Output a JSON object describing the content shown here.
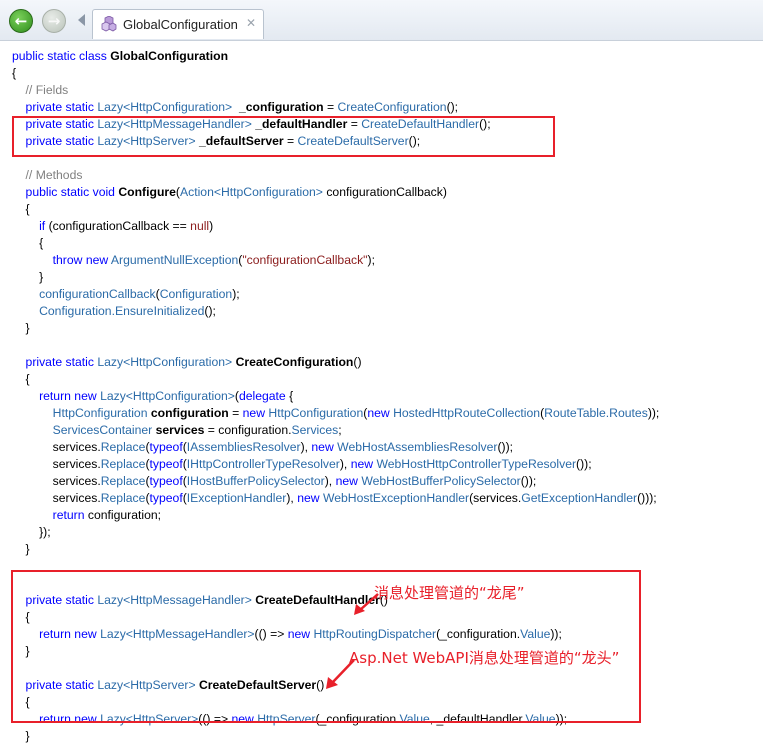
{
  "toolbar": {
    "back_icon": "arrow-left-icon",
    "forward_icon": "arrow-right-icon",
    "tab_title": "GlobalConfiguration",
    "tab_close": "✕"
  },
  "code_lines": [
    [
      {
        "t": "public static class ",
        "c": "kw"
      },
      {
        "t": "GlobalConfiguration",
        "c": "bd"
      }
    ],
    [
      {
        "t": "{",
        "c": ""
      }
    ],
    [
      {
        "t": "    // Fields",
        "c": "cm"
      }
    ],
    [
      {
        "t": "    private static ",
        "c": "kw"
      },
      {
        "t": "Lazy<HttpConfiguration>",
        "c": "ty"
      },
      {
        "t": "  ",
        "c": ""
      },
      {
        "t": "_configuration",
        "c": "bd"
      },
      {
        "t": " = ",
        "c": ""
      },
      {
        "t": "CreateConfiguration",
        "c": "ty"
      },
      {
        "t": "();",
        "c": ""
      }
    ],
    [
      {
        "t": "    private static ",
        "c": "kw"
      },
      {
        "t": "Lazy<HttpMessageHandler>",
        "c": "ty"
      },
      {
        "t": " ",
        "c": ""
      },
      {
        "t": "_defaultHandler",
        "c": "bd"
      },
      {
        "t": " = ",
        "c": ""
      },
      {
        "t": "CreateDefaultHandler",
        "c": "ty"
      },
      {
        "t": "();",
        "c": ""
      }
    ],
    [
      {
        "t": "    private static ",
        "c": "kw"
      },
      {
        "t": "Lazy<HttpServer>",
        "c": "ty"
      },
      {
        "t": " ",
        "c": ""
      },
      {
        "t": "_defaultServer",
        "c": "bd"
      },
      {
        "t": " = ",
        "c": ""
      },
      {
        "t": "CreateDefaultServer",
        "c": "ty"
      },
      {
        "t": "();",
        "c": ""
      }
    ],
    [
      {
        "t": "",
        "c": ""
      }
    ],
    [
      {
        "t": "    // Methods",
        "c": "cm"
      }
    ],
    [
      {
        "t": "    public static void ",
        "c": "kw"
      },
      {
        "t": "Configure",
        "c": "bd"
      },
      {
        "t": "(",
        "c": ""
      },
      {
        "t": "Action<HttpConfiguration>",
        "c": "ty"
      },
      {
        "t": " configurationCallback)",
        "c": ""
      }
    ],
    [
      {
        "t": "    {",
        "c": ""
      }
    ],
    [
      {
        "t": "        if ",
        "c": "kw"
      },
      {
        "t": "(configurationCallback == ",
        "c": ""
      },
      {
        "t": "null",
        "c": "st"
      },
      {
        "t": ")",
        "c": ""
      }
    ],
    [
      {
        "t": "        {",
        "c": ""
      }
    ],
    [
      {
        "t": "            throw new ",
        "c": "kw"
      },
      {
        "t": "ArgumentNullException",
        "c": "ty"
      },
      {
        "t": "(",
        "c": ""
      },
      {
        "t": "\"configurationCallback\"",
        "c": "st"
      },
      {
        "t": ");",
        "c": ""
      }
    ],
    [
      {
        "t": "        }",
        "c": ""
      }
    ],
    [
      {
        "t": "        ",
        "c": ""
      },
      {
        "t": "configurationCallback",
        "c": "ty"
      },
      {
        "t": "(",
        "c": ""
      },
      {
        "t": "Configuration",
        "c": "ty"
      },
      {
        "t": ");",
        "c": ""
      }
    ],
    [
      {
        "t": "        ",
        "c": ""
      },
      {
        "t": "Configuration.EnsureInitialized",
        "c": "ty"
      },
      {
        "t": "();",
        "c": ""
      }
    ],
    [
      {
        "t": "    }",
        "c": ""
      }
    ],
    [
      {
        "t": "",
        "c": ""
      }
    ],
    [
      {
        "t": "    private static ",
        "c": "kw"
      },
      {
        "t": "Lazy<HttpConfiguration>",
        "c": "ty"
      },
      {
        "t": " ",
        "c": ""
      },
      {
        "t": "CreateConfiguration",
        "c": "bd"
      },
      {
        "t": "()",
        "c": ""
      }
    ],
    [
      {
        "t": "    {",
        "c": ""
      }
    ],
    [
      {
        "t": "        return new ",
        "c": "kw"
      },
      {
        "t": "Lazy<HttpConfiguration>",
        "c": "ty"
      },
      {
        "t": "(",
        "c": ""
      },
      {
        "t": "delegate",
        "c": "kw"
      },
      {
        "t": " {",
        "c": ""
      }
    ],
    [
      {
        "t": "            ",
        "c": ""
      },
      {
        "t": "HttpConfiguration",
        "c": "ty"
      },
      {
        "t": " ",
        "c": ""
      },
      {
        "t": "configuration",
        "c": "bd"
      },
      {
        "t": " = ",
        "c": ""
      },
      {
        "t": "new ",
        "c": "kw"
      },
      {
        "t": "HttpConfiguration",
        "c": "ty"
      },
      {
        "t": "(",
        "c": ""
      },
      {
        "t": "new ",
        "c": "kw"
      },
      {
        "t": "HostedHttpRouteCollection",
        "c": "ty"
      },
      {
        "t": "(",
        "c": ""
      },
      {
        "t": "RouteTable.Routes",
        "c": "ty"
      },
      {
        "t": "));",
        "c": ""
      }
    ],
    [
      {
        "t": "            ",
        "c": ""
      },
      {
        "t": "ServicesContainer",
        "c": "ty"
      },
      {
        "t": " ",
        "c": ""
      },
      {
        "t": "services",
        "c": "bd"
      },
      {
        "t": " = configuration.",
        "c": ""
      },
      {
        "t": "Services",
        "c": "ty"
      },
      {
        "t": ";",
        "c": ""
      }
    ],
    [
      {
        "t": "            services.",
        "c": ""
      },
      {
        "t": "Replace",
        "c": "ty"
      },
      {
        "t": "(",
        "c": ""
      },
      {
        "t": "typeof",
        "c": "kw"
      },
      {
        "t": "(",
        "c": ""
      },
      {
        "t": "IAssembliesResolver",
        "c": "ty"
      },
      {
        "t": "), ",
        "c": ""
      },
      {
        "t": "new ",
        "c": "kw"
      },
      {
        "t": "WebHostAssembliesResolver",
        "c": "ty"
      },
      {
        "t": "());",
        "c": ""
      }
    ],
    [
      {
        "t": "            services.",
        "c": ""
      },
      {
        "t": "Replace",
        "c": "ty"
      },
      {
        "t": "(",
        "c": ""
      },
      {
        "t": "typeof",
        "c": "kw"
      },
      {
        "t": "(",
        "c": ""
      },
      {
        "t": "IHttpControllerTypeResolver",
        "c": "ty"
      },
      {
        "t": "), ",
        "c": ""
      },
      {
        "t": "new ",
        "c": "kw"
      },
      {
        "t": "WebHostHttpControllerTypeResolver",
        "c": "ty"
      },
      {
        "t": "());",
        "c": ""
      }
    ],
    [
      {
        "t": "            services.",
        "c": ""
      },
      {
        "t": "Replace",
        "c": "ty"
      },
      {
        "t": "(",
        "c": ""
      },
      {
        "t": "typeof",
        "c": "kw"
      },
      {
        "t": "(",
        "c": ""
      },
      {
        "t": "IHostBufferPolicySelector",
        "c": "ty"
      },
      {
        "t": "), ",
        "c": ""
      },
      {
        "t": "new ",
        "c": "kw"
      },
      {
        "t": "WebHostBufferPolicySelector",
        "c": "ty"
      },
      {
        "t": "());",
        "c": ""
      }
    ],
    [
      {
        "t": "            services.",
        "c": ""
      },
      {
        "t": "Replace",
        "c": "ty"
      },
      {
        "t": "(",
        "c": ""
      },
      {
        "t": "typeof",
        "c": "kw"
      },
      {
        "t": "(",
        "c": ""
      },
      {
        "t": "IExceptionHandler",
        "c": "ty"
      },
      {
        "t": "), ",
        "c": ""
      },
      {
        "t": "new ",
        "c": "kw"
      },
      {
        "t": "WebHostExceptionHandler",
        "c": "ty"
      },
      {
        "t": "(services.",
        "c": ""
      },
      {
        "t": "GetExceptionHandler",
        "c": "ty"
      },
      {
        "t": "()));",
        "c": ""
      }
    ],
    [
      {
        "t": "            return ",
        "c": "kw"
      },
      {
        "t": "configuration;",
        "c": ""
      }
    ],
    [
      {
        "t": "        });",
        "c": ""
      }
    ],
    [
      {
        "t": "    }",
        "c": ""
      }
    ],
    [
      {
        "t": "",
        "c": ""
      }
    ],
    [
      {
        "t": "",
        "c": ""
      }
    ],
    [
      {
        "t": "    private static ",
        "c": "kw"
      },
      {
        "t": "Lazy<HttpMessageHandler>",
        "c": "ty"
      },
      {
        "t": " ",
        "c": ""
      },
      {
        "t": "CreateDefaultHandler",
        "c": "bd"
      },
      {
        "t": "()",
        "c": ""
      }
    ],
    [
      {
        "t": "    {",
        "c": ""
      }
    ],
    [
      {
        "t": "        return new ",
        "c": "kw"
      },
      {
        "t": "Lazy<HttpMessageHandler>",
        "c": "ty"
      },
      {
        "t": "(() => ",
        "c": ""
      },
      {
        "t": "new ",
        "c": "kw"
      },
      {
        "t": "HttpRoutingDispatcher",
        "c": "ty"
      },
      {
        "t": "(_configuration.",
        "c": ""
      },
      {
        "t": "Value",
        "c": "ty"
      },
      {
        "t": "));",
        "c": ""
      }
    ],
    [
      {
        "t": "    }",
        "c": ""
      }
    ],
    [
      {
        "t": "",
        "c": ""
      }
    ],
    [
      {
        "t": "    private static ",
        "c": "kw"
      },
      {
        "t": "Lazy<HttpServer>",
        "c": "ty"
      },
      {
        "t": " ",
        "c": ""
      },
      {
        "t": "CreateDefaultServer",
        "c": "bd"
      },
      {
        "t": "()",
        "c": ""
      }
    ],
    [
      {
        "t": "    {",
        "c": ""
      }
    ],
    [
      {
        "t": "        return new ",
        "c": "kw"
      },
      {
        "t": "Lazy<HttpServer>",
        "c": "ty"
      },
      {
        "t": "(() => ",
        "c": ""
      },
      {
        "t": "new ",
        "c": "kw"
      },
      {
        "t": "HttpServer",
        "c": "ty"
      },
      {
        "t": "(_configuration.",
        "c": ""
      },
      {
        "t": "Value",
        "c": "ty"
      },
      {
        "t": ", _defaultHandler.",
        "c": ""
      },
      {
        "t": "Value",
        "c": "ty"
      },
      {
        "t": "));",
        "c": ""
      }
    ],
    [
      {
        "t": "    }",
        "c": ""
      }
    ]
  ],
  "annotations": {
    "tail_label": "消息处理管道的“龙尾”",
    "head_label": "Asp.Net WebAPI消息处理管道的“龙头”"
  },
  "colors": {
    "keyword": "#0000ff",
    "type": "#2b6ba8",
    "comment": "#808080",
    "string": "#8b1c1c",
    "highlight": "#e8202a"
  }
}
